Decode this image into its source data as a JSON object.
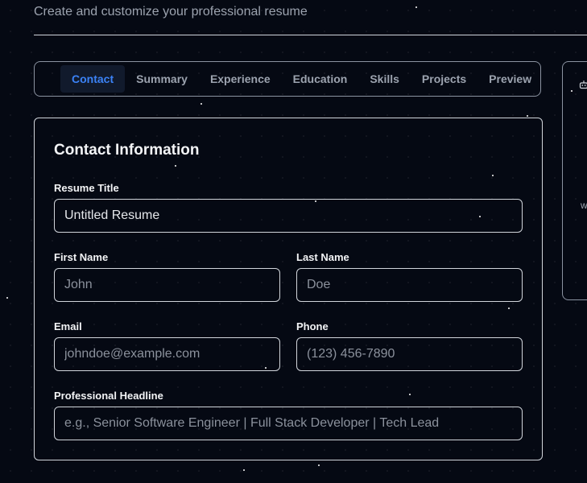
{
  "header": {
    "subtitle": "Create and customize your professional resume"
  },
  "tabs": [
    {
      "label": "Contact",
      "active": true
    },
    {
      "label": "Summary",
      "active": false
    },
    {
      "label": "Experience",
      "active": false
    },
    {
      "label": "Education",
      "active": false
    },
    {
      "label": "Skills",
      "active": false
    },
    {
      "label": "Projects",
      "active": false
    },
    {
      "label": "Preview",
      "active": false
    }
  ],
  "side_panel": {
    "icon": "robot-icon",
    "letter": "w"
  },
  "form": {
    "title": "Contact Information",
    "resume_title": {
      "label": "Resume Title",
      "value": "Untitled Resume",
      "placeholder": ""
    },
    "first_name": {
      "label": "First Name",
      "value": "",
      "placeholder": "John"
    },
    "last_name": {
      "label": "Last Name",
      "value": "",
      "placeholder": "Doe"
    },
    "email": {
      "label": "Email",
      "value": "",
      "placeholder": "johndoe@example.com"
    },
    "phone": {
      "label": "Phone",
      "value": "",
      "placeholder": "(123) 456-7890"
    },
    "headline": {
      "label": "Professional Headline",
      "value": "",
      "placeholder": "e.g., Senior Software Engineer | Full Stack Developer | Tech Lead"
    }
  },
  "colors": {
    "background": "#050913",
    "accent": "#3b82f6",
    "border": "#d1d5db",
    "muted_text": "#9ca3af"
  }
}
